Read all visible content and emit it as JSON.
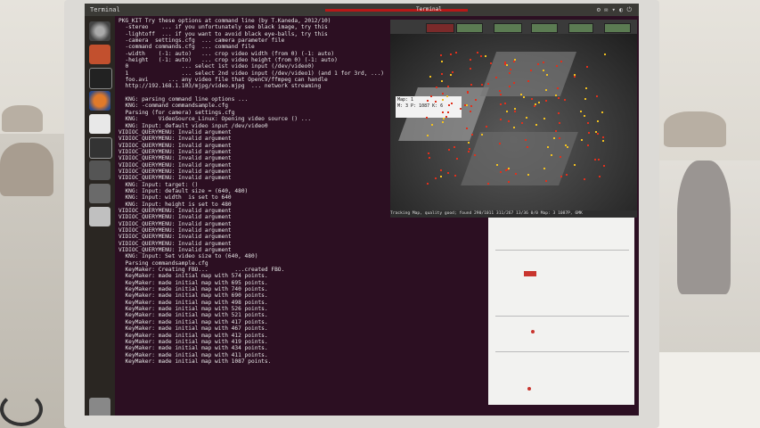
{
  "topbar": {
    "window_title": "Terminal",
    "center_label": "Terminal"
  },
  "terminal": {
    "lines": [
      "PKG_KIT Try these options at command line (by T.Kaneda, 2012/10)",
      "  -stereo    ... if you unfortunately see black image, try this",
      "  -lightoff  ... if you want to avoid black eye-balls, try this",
      "  -camera  settings.cfg  ... camera parameter file",
      "  -command commands.cfg  ... command file",
      "  -width    (-1: auto)   ... crop video width (from 0) (-1: auto)",
      "  -height   (-1: auto)   ... crop video height (from 0) (-1: auto)",
      "  0                ... select 1st video input (/dev/video0)",
      "  1                ... select 2nd video input (/dev/video1) (and 1 for 3rd, ...)",
      "  foo.avi      ... any video file that OpenCV/ffmpeg can handle",
      "  http://192.168.1.103/mjpg/video.mjpg  ... network streaming",
      "",
      "  KNG: parsing command line options ...",
      "  KNG: -command commandsample.cfg",
      "  Parsing (for camera) settings.cfg",
      "  KNG:      VideoSource_Linux: Opening video source () ...",
      "  KNG: Input: default video input /dev/video0",
      "VIDIOC_QUERYMENU: Invalid argument",
      "VIDIOC_QUERYMENU: Invalid argument",
      "VIDIOC_QUERYMENU: Invalid argument",
      "VIDIOC_QUERYMENU: Invalid argument",
      "VIDIOC_QUERYMENU: Invalid argument",
      "VIDIOC_QUERYMENU: Invalid argument",
      "VIDIOC_QUERYMENU: Invalid argument",
      "VIDIOC_QUERYMENU: Invalid argument",
      "  KNG: Input: target: ()",
      "  KNG: Input: default size = (640, 480)",
      "  KNG: Input: width  is set to 640",
      "  KNG: Input: height is set to 480",
      "VIDIOC_QUERYMENU: Invalid argument",
      "VIDIOC_QUERYMENU: Invalid argument",
      "VIDIOC_QUERYMENU: Invalid argument",
      "VIDIOC_QUERYMENU: Invalid argument",
      "VIDIOC_QUERYMENU: Invalid argument",
      "VIDIOC_QUERYMENU: Invalid argument",
      "VIDIOC_QUERYMENU: Invalid argument",
      "  KNG: Input: Set video size to (640, 480)",
      "  Parsing commandsample.cfg",
      "  KeyMaker: Creating FBO...        ...created FBO.",
      "  KeyMaker: made initial map with 574 points.",
      "  KeyMaker: made initial map with 695 points.",
      "  KeyMaker: made initial map with 740 points.",
      "  KeyMaker: made initial map with 690 points.",
      "  KeyMaker: made initial map with 498 points.",
      "  KeyMaker: made initial map with 526 points.",
      "  KeyMaker: made initial map with 521 points.",
      "  KeyMaker: made initial map with 417 points.",
      "  KeyMaker: made initial map with 467 points.",
      "  KeyMaker: made initial map with 412 points.",
      "  KeyMaker: made initial map with 419 points.",
      "  KeyMaker: made initial map with 434 points.",
      "  KeyMaker: made initial map with 411 points.",
      "  KeyMaker: made initial map with 1087 points."
    ]
  },
  "map_window": {
    "info_line1": "Map: 1",
    "info_line2": "M: 3 P: 1087 K: 6",
    "status": "Tracking Map, quality good; found 290/1011 311/267 13/36 0/0 Map: 3 1087P, 6MK"
  },
  "colors": {
    "terminal_bg": "#2c0f22",
    "accent_red": "#c9352e",
    "map_point_red": "#e0301c",
    "map_point_yellow": "#f0c020"
  },
  "icons": [
    "ubuntu-dash-icon",
    "files-icon",
    "terminal-icon",
    "firefox-icon",
    "document-icon",
    "monitor-icon",
    "settings-icon",
    "app-icon",
    "app-icon",
    "trash-icon"
  ]
}
